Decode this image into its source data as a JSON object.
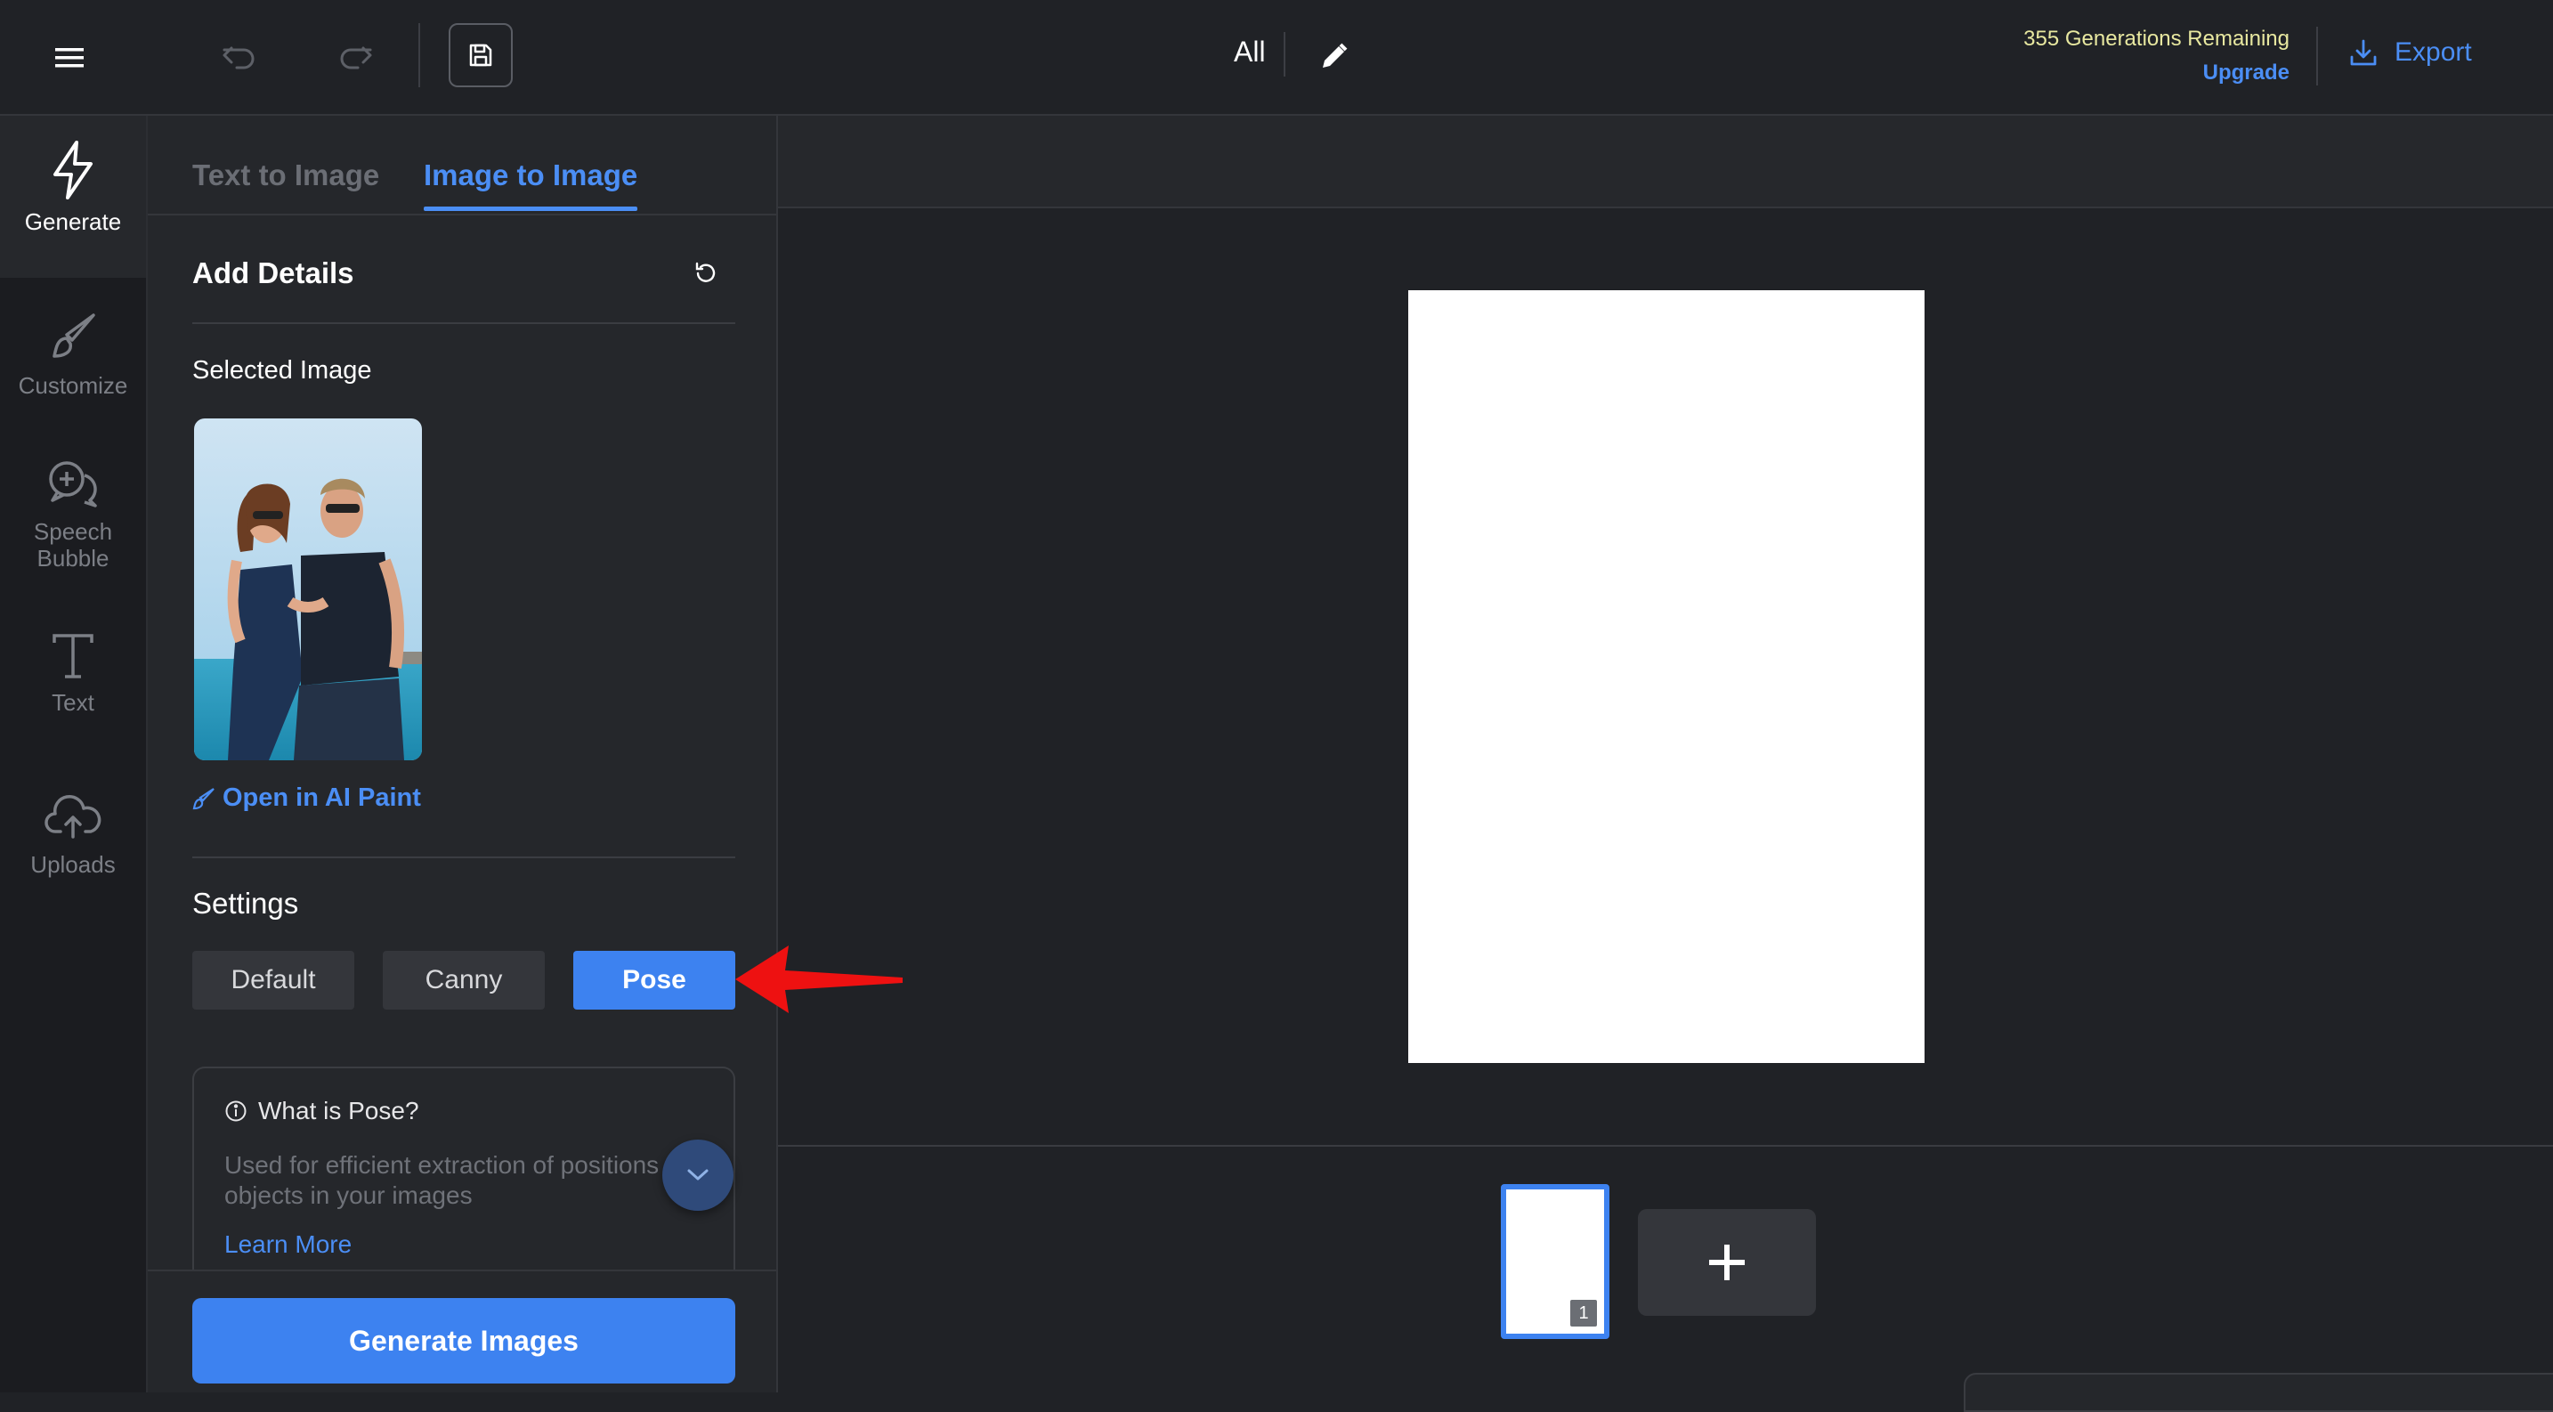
{
  "topbar": {
    "view_label": "All",
    "generations_remaining": "355 Generations Remaining",
    "upgrade_label": "Upgrade",
    "export_label": "Export"
  },
  "rail": {
    "items": [
      {
        "label": "Generate",
        "icon": "lightning-icon",
        "active": true
      },
      {
        "label": "Customize",
        "icon": "brush-icon",
        "active": false
      },
      {
        "label": "Speech Bubble",
        "icon": "speech-bubble-icon",
        "active": false
      },
      {
        "label": "Text",
        "icon": "text-icon",
        "active": false
      },
      {
        "label": "Uploads",
        "icon": "cloud-upload-icon",
        "active": false
      }
    ]
  },
  "panel": {
    "tabs": [
      {
        "label": "Text to Image",
        "active": false
      },
      {
        "label": "Image to Image",
        "active": true
      }
    ],
    "section_title": "Add Details",
    "selected_image_label": "Selected Image",
    "open_ai_paint_label": "Open in AI Paint",
    "settings_label": "Settings",
    "settings_options": [
      {
        "label": "Default",
        "active": false
      },
      {
        "label": "Canny",
        "active": false
      },
      {
        "label": "Pose",
        "active": true
      }
    ],
    "info": {
      "title": "What is Pose?",
      "description": "Used for efficient extraction of positions of objects in your images",
      "learn_more": "Learn More"
    },
    "generate_button": "Generate Images"
  },
  "filmstrip": {
    "pages": [
      {
        "number": "1",
        "selected": true
      }
    ]
  },
  "colors": {
    "accent": "#3d82f0",
    "background": "#202226",
    "panel": "#25272b",
    "annotation_arrow": "#ee1111"
  }
}
